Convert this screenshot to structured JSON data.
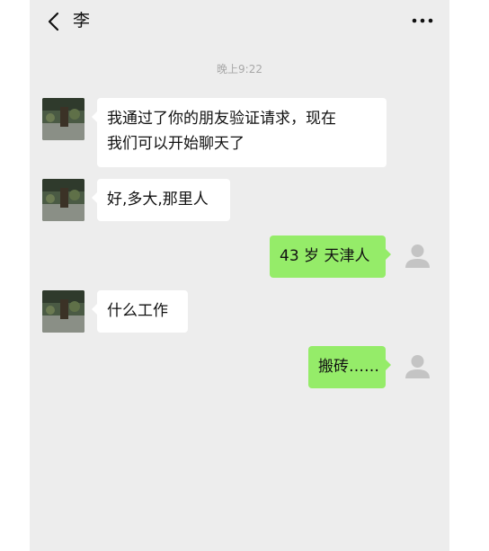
{
  "header": {
    "title": "李",
    "back_icon": "chevron-left-icon",
    "more_icon": "more-dots-icon"
  },
  "chat": {
    "timestamp": "晚上9:22",
    "messages": [
      {
        "side": "in",
        "lines": [
          "我通过了你的朋友验证请求，现在",
          "我们可以开始聊天了"
        ]
      },
      {
        "side": "in",
        "lines": [
          "好,多大,那里人"
        ]
      },
      {
        "side": "out",
        "lines": [
          "43 岁 天津人"
        ]
      },
      {
        "side": "in",
        "lines": [
          "什么工作"
        ]
      },
      {
        "side": "out",
        "lines": [
          "搬砖……"
        ]
      }
    ]
  },
  "colors": {
    "background": "#ededed",
    "outgoing_bubble": "#95ec69",
    "incoming_bubble": "#ffffff"
  }
}
